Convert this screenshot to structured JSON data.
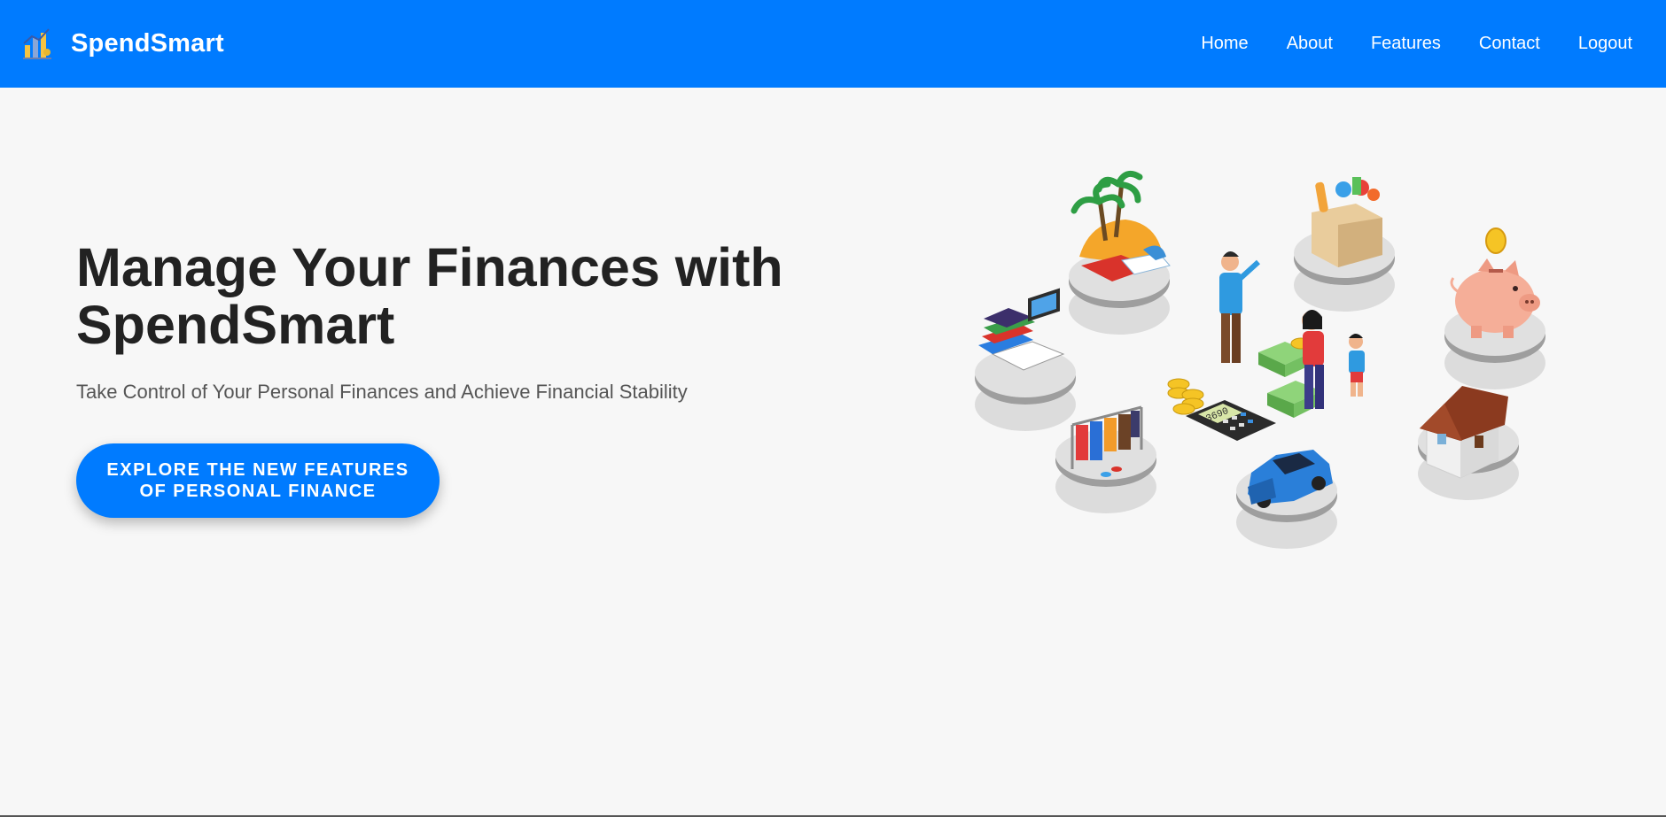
{
  "header": {
    "brand_name": "SpendSmart",
    "logo_icon": "finance-growth-logo-icon",
    "nav": [
      {
        "label": "Home"
      },
      {
        "label": "About"
      },
      {
        "label": "Features"
      },
      {
        "label": "Contact"
      },
      {
        "label": "Logout"
      }
    ]
  },
  "hero": {
    "title": "Manage Your Finances with SpendSmart",
    "subtitle": "Take Control of Your Personal Finances and Achieve Financial Stability",
    "cta_label": "EXPLORE THE NEW FEATURES OF PERSONAL FINANCE",
    "illustration": "isometric-personal-finance-illustration",
    "calculator_display": "3690"
  },
  "colors": {
    "primary": "#007bff",
    "background": "#f7f7f7",
    "heading": "#222222",
    "subtitle": "#555555"
  }
}
